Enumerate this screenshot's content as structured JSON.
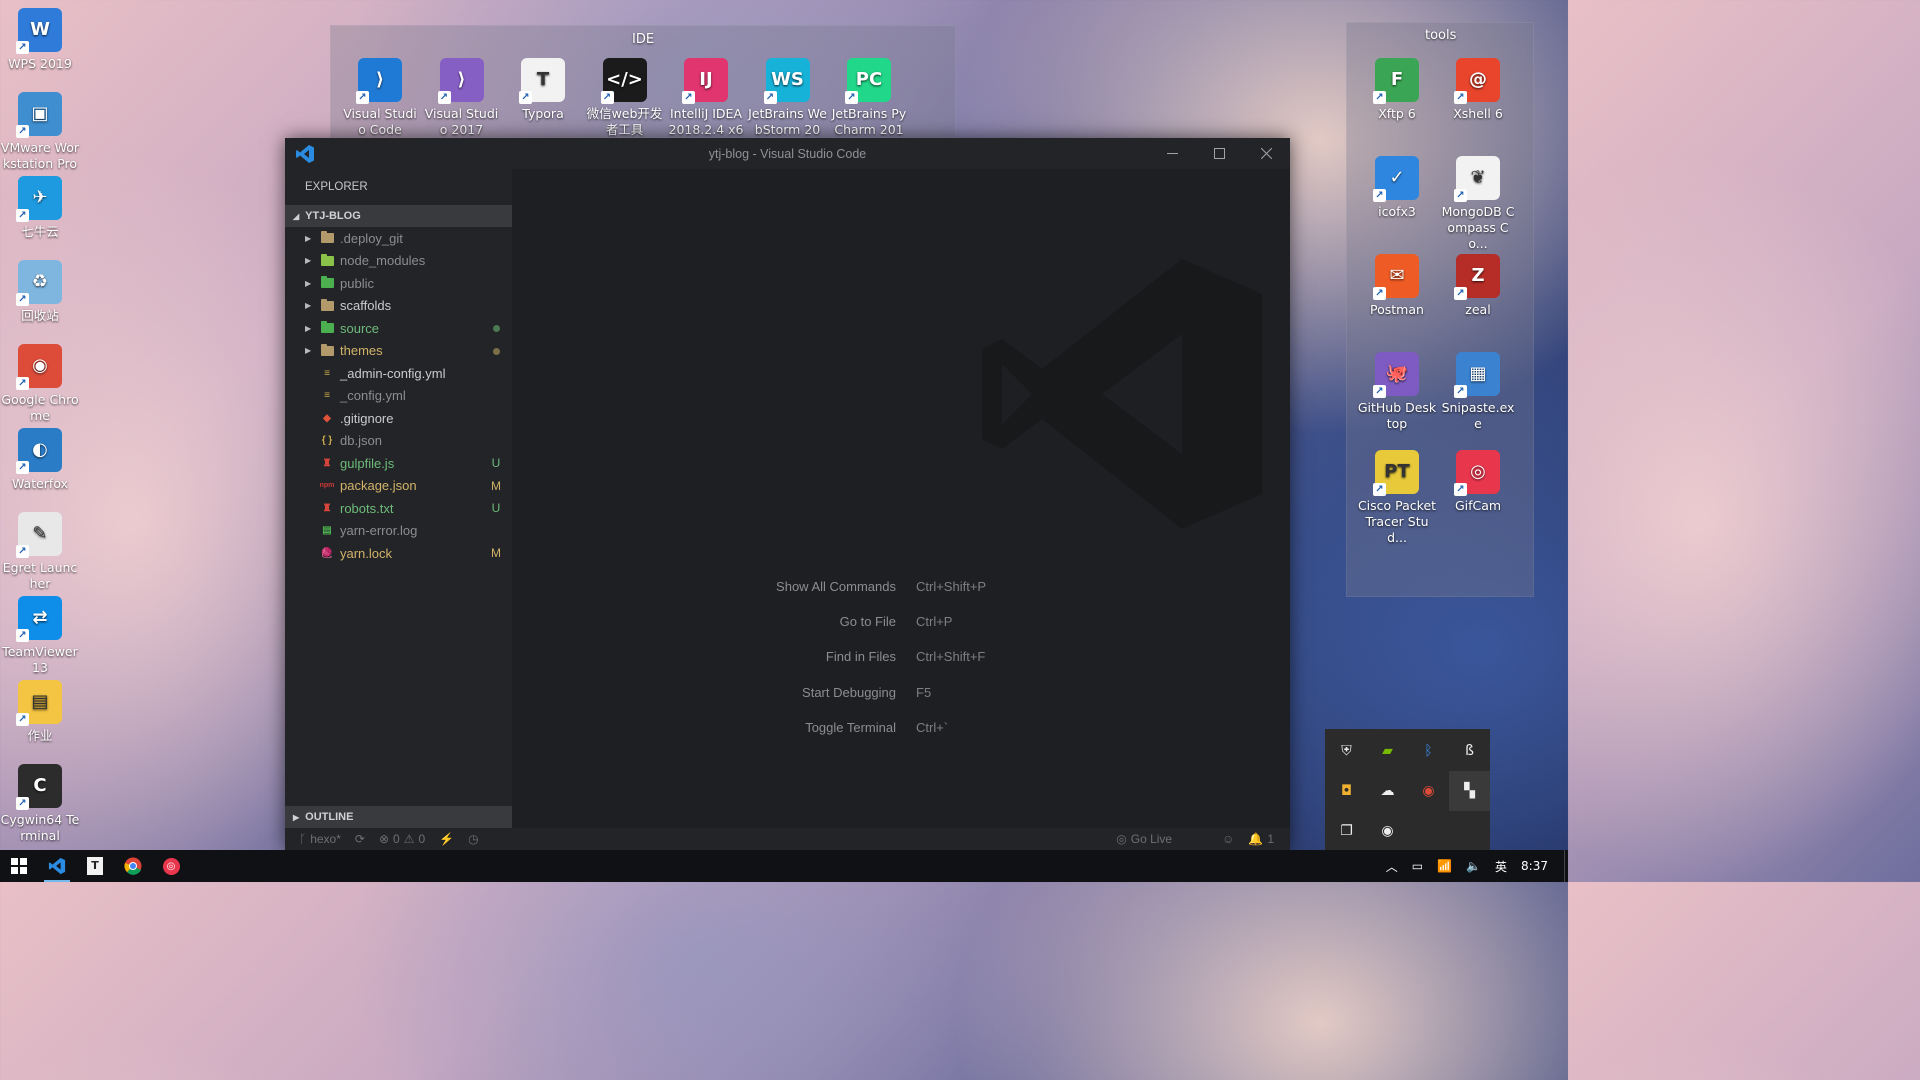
{
  "desktop": {
    "left_icons": [
      {
        "label": "WPS 2019",
        "color": "#2f7bd9",
        "glyph": "W",
        "name": "wps-icon"
      },
      {
        "label": "VMware Workstation Pro",
        "color": "#3e8ed0",
        "glyph": "▣",
        "name": "vmware-icon"
      },
      {
        "label": "七牛云",
        "color": "#1d9ae0",
        "glyph": "✈",
        "name": "qiniu-icon"
      },
      {
        "label": "回收站",
        "color": "#7fb6e0",
        "glyph": "♻",
        "name": "recycle-bin-icon"
      },
      {
        "label": "Google Chrome",
        "color": "#dd4b39",
        "glyph": "◉",
        "name": "chrome-icon"
      },
      {
        "label": "Waterfox",
        "color": "#2a7cc7",
        "glyph": "◐",
        "name": "waterfox-icon"
      },
      {
        "label": "Egret Launcher",
        "color": "#e8e8e8",
        "glyph": "✎",
        "name": "egret-icon"
      },
      {
        "label": "TeamViewer 13",
        "color": "#0e8ee9",
        "glyph": "⇄",
        "name": "teamviewer-icon"
      },
      {
        "label": "作业",
        "color": "#f4c542",
        "glyph": "▤",
        "name": "folder-icon"
      },
      {
        "label": "Cygwin64 Terminal",
        "color": "#2c2c2c",
        "glyph": "C",
        "name": "cygwin-icon"
      }
    ],
    "ide_fence": {
      "title": "IDE",
      "icons": [
        {
          "label": "Visual Studio Code",
          "color": "#1f7ad6",
          "glyph": "⟩",
          "name": "vscode-desktop-icon"
        },
        {
          "label": "Visual Studio 2017",
          "color": "#865fc5",
          "glyph": "⟩",
          "name": "visual-studio-icon"
        },
        {
          "label": "Typora",
          "color": "#f2f2f2",
          "glyph": "T",
          "name": "typora-icon"
        },
        {
          "label": "微信web开发者工具",
          "color": "#1b1b1b",
          "glyph": "</>",
          "name": "wechat-devtools-icon"
        },
        {
          "label": "IntelliJ IDEA 2018.2.4 x64",
          "color": "#e0356e",
          "glyph": "IJ",
          "name": "intellij-icon"
        },
        {
          "label": "JetBrains WebStorm 20",
          "color": "#16b2d8",
          "glyph": "WS",
          "name": "webstorm-icon"
        },
        {
          "label": "JetBrains PyCharm 201",
          "color": "#21d789",
          "glyph": "PC",
          "name": "pycharm-icon"
        }
      ]
    },
    "tools_fence": {
      "title": "tools",
      "icons": [
        {
          "label": "Xftp 6",
          "color": "#3aa655",
          "glyph": "F",
          "name": "xftp-icon"
        },
        {
          "label": "Xshell 6",
          "color": "#e8452c",
          "glyph": "@",
          "name": "xshell-icon"
        },
        {
          "label": "icofx3",
          "color": "#2e86de",
          "glyph": "✓",
          "name": "icofx-icon"
        },
        {
          "label": "MongoDB Compass Co...",
          "color": "#f2f2f2",
          "glyph": "❦",
          "name": "mongodb-icon"
        },
        {
          "label": "Postman",
          "color": "#ef5b25",
          "glyph": "✉",
          "name": "postman-icon"
        },
        {
          "label": "zeal",
          "color": "#b52d26",
          "glyph": "Z",
          "name": "zeal-icon"
        },
        {
          "label": "GitHub Desktop",
          "color": "#7e5bc2",
          "glyph": "🐙",
          "name": "github-desktop-icon"
        },
        {
          "label": "Snipaste.exe",
          "color": "#3b82d0",
          "glyph": "▦",
          "name": "snipaste-icon"
        },
        {
          "label": "Cisco Packet Tracer Stud...",
          "color": "#e7c93a",
          "glyph": "PT",
          "name": "packet-tracer-icon"
        },
        {
          "label": "GifCam",
          "color": "#e8364d",
          "glyph": "◎",
          "name": "gifcam-icon"
        }
      ]
    }
  },
  "vscode": {
    "window_title": "ytj-blog - Visual Studio Code",
    "explorer_label": "EXPLORER",
    "project": "YTJ-BLOG",
    "files": [
      {
        "name": ".deploy_git",
        "type": "folder",
        "color": "#8b8d91",
        "icon_color": "#b39a6a",
        "status": "",
        "expandable": true
      },
      {
        "name": "node_modules",
        "type": "folder",
        "color": "#8b8d91",
        "icon_color": "#8bc34a",
        "status": "",
        "expandable": true
      },
      {
        "name": "public",
        "type": "folder",
        "color": "#8b8d91",
        "icon_color": "#4caf50",
        "status": "",
        "expandable": true
      },
      {
        "name": "scaffolds",
        "type": "folder",
        "color": "#c9cbcf",
        "icon_color": "#b39a6a",
        "status": "",
        "expandable": true
      },
      {
        "name": "source",
        "type": "folder",
        "color": "#6dbb7a",
        "icon_color": "#4caf50",
        "status": "dot",
        "dot_color": "#4b7a52",
        "expandable": true
      },
      {
        "name": "themes",
        "type": "folder",
        "color": "#d2b36a",
        "icon_color": "#b39a6a",
        "status": "dot",
        "dot_color": "#7a6f49",
        "expandable": true
      },
      {
        "name": "_admin-config.yml",
        "type": "yml",
        "color": "#c9cbcf",
        "icon_color": "#c9a94a",
        "status": "",
        "expandable": false
      },
      {
        "name": "_config.yml",
        "type": "yml",
        "color": "#8b8d91",
        "icon_color": "#c9a94a",
        "status": "",
        "expandable": false
      },
      {
        "name": ".gitignore",
        "type": "git",
        "color": "#c9cbcf",
        "icon_color": "#e0533a",
        "status": "",
        "expandable": false
      },
      {
        "name": "db.json",
        "type": "json",
        "color": "#8b8d91",
        "icon_color": "#c9a94a",
        "status": "",
        "expandable": false
      },
      {
        "name": "gulpfile.js",
        "type": "gulp",
        "color": "#6dbb7a",
        "icon_color": "#d8453a",
        "status": "U",
        "status_color": "#6dbb7a",
        "expandable": false
      },
      {
        "name": "package.json",
        "type": "npm",
        "color": "#d2b36a",
        "icon_color": "#cb3837",
        "status": "M",
        "status_color": "#d2b36a",
        "expandable": false
      },
      {
        "name": "robots.txt",
        "type": "robot",
        "color": "#6dbb7a",
        "icon_color": "#d8453a",
        "status": "U",
        "status_color": "#6dbb7a",
        "expandable": false
      },
      {
        "name": "yarn-error.log",
        "type": "log",
        "color": "#8b8d91",
        "icon_color": "#4caf50",
        "status": "",
        "expandable": false
      },
      {
        "name": "yarn.lock",
        "type": "yarn",
        "color": "#d2b36a",
        "icon_color": "#2c8ebb",
        "status": "M",
        "status_color": "#d2b36a",
        "expandable": false
      }
    ],
    "outline_label": "OUTLINE",
    "shortcuts": [
      {
        "cmd": "Show All Commands",
        "key": "Ctrl+Shift+P"
      },
      {
        "cmd": "Go to File",
        "key": "Ctrl+P"
      },
      {
        "cmd": "Find in Files",
        "key": "Ctrl+Shift+F"
      },
      {
        "cmd": "Start Debugging",
        "key": "F5"
      },
      {
        "cmd": "Toggle Terminal",
        "key": "Ctrl+`"
      }
    ],
    "status": {
      "branch": "hexo*",
      "errors": "0",
      "warnings": "0",
      "go_live": "Go Live",
      "notifications": "1"
    }
  },
  "taskbar": {
    "time": "8:37",
    "ime": "英",
    "volume": "🔈",
    "wifi": "📶",
    "battery": "▭"
  }
}
